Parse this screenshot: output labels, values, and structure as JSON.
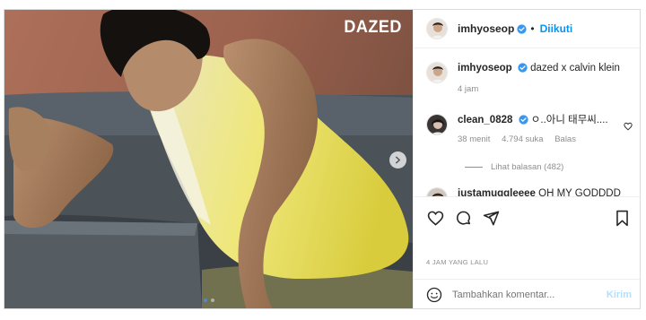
{
  "post": {
    "brand_logo": "DAZED",
    "carousel": {
      "slide_count": 2,
      "active_index": 0
    }
  },
  "header": {
    "username": "imhyoseop",
    "separator": "•",
    "follow_state": "Diikuti"
  },
  "caption": {
    "username": "imhyoseop",
    "text": "dazed x calvin klein",
    "time": "4 jam"
  },
  "comments": [
    {
      "username": "clean_0828",
      "text": "ㅇ..아니 태무씨....",
      "time": "38 menit",
      "likes": "4.794 suka",
      "reply_label": "Balas",
      "view_replies": "Lihat balasan (482)"
    },
    {
      "username": "justamuggleeee",
      "text": "OH MY GODDDD"
    }
  ],
  "actions": {
    "icons": [
      "heart-icon",
      "comment-icon",
      "share-icon",
      "bookmark-icon"
    ]
  },
  "posted_date": "4 JAM YANG LALU",
  "composer": {
    "placeholder": "Tambahkan komentar...",
    "send_label": "Kirim"
  },
  "colors": {
    "accent": "#0095f6",
    "verified": "#3897f0",
    "muted": "#8e8e8e",
    "send_disabled": "#b2dffc"
  }
}
